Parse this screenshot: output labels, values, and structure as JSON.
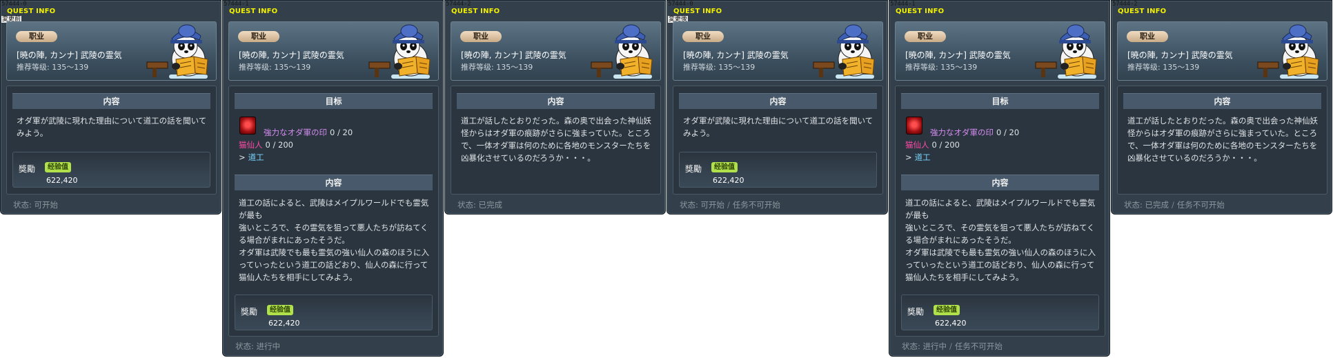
{
  "common": {
    "window_title": "QUEST INFO",
    "job_badge": "职业",
    "quest_name": "[暁の陣, カンナ] 武陵の霊気",
    "level": "推荐等级: 135～139",
    "section_goal": "目标",
    "section_content": "内容",
    "reward_label": "獎勵",
    "exp_label": "经验值",
    "exp_value": "622,420",
    "status_prefix": "状态:",
    "goal_mob": "強力なオダ軍の印",
    "goal_mob_count": "0 / 20",
    "goal_npc": "猫仙人",
    "goal_npc_count": "0 / 200",
    "goal_dest_arrow": ">",
    "goal_dest": "道工",
    "separator": "/",
    "npc_icon": "panda-npc-reading-icon",
    "goal_icon": "red-seal-icon",
    "colors": {
      "panel_bg": "#33404b",
      "title": "#f4f100",
      "exp_badge": "#b0e14a",
      "mob": "#d58cf2",
      "npc": "#ff4aa8",
      "dest": "#78d6ff"
    }
  },
  "panels": [
    {
      "id": "57444-0",
      "sub": "変更前",
      "content": "オダ軍が武陵に現れた理由について道工の話を聞いてみよう。",
      "status": "可开始",
      "status_extra": ""
    },
    {
      "id": "57444-1",
      "content": "道工の話によると、武陵はメイプルワールドでも霊気が最も\n強いところで、その霊気を狙って悪人たちが訪ねてくる場合がまれにあったそうだ。\nオダ軍は武陵でも最も霊気の強い仙人の森のほうに入っていったという道工の話どおり、仙人の森に行って猫仙人たちを相手にしてみよう。",
      "status": "进行中",
      "status_extra": ""
    },
    {
      "id": "57444-2",
      "content": "道工が話したとおりだった。森の奥で出会った神仙妖怪からはオダ軍の痕跡がさらに強まっていた。ところで、一体オダ軍は何のために各地のモンスターたちを凶暴化させているのだろうか・・・。",
      "status": "已完成",
      "status_extra": ""
    },
    {
      "id": "57444-0",
      "sub": "変更後",
      "content": "オダ軍が武陵に現れた理由について道工の話を聞いてみよう。",
      "status": "可开始",
      "status_extra": "任务不可开始"
    },
    {
      "id": "57444-1",
      "content": "道工の話によると、武陵はメイプルワールドでも霊気が最も\n強いところで、その霊気を狙って悪人たちが訪ねてくる場合がまれにあったそうだ。\nオダ軍は武陵でも最も霊気の強い仙人の森のほうに入っていったという道工の話どおり、仙人の森に行って猫仙人たちを相手にしてみよう。",
      "status": "进行中",
      "status_extra": "任务不可开始"
    },
    {
      "id": "57444-2",
      "content": "道工が話したとおりだった。森の奥で出会った神仙妖怪からはオダ軍の痕跡がさらに強まっていた。ところで、一体オダ軍は何のために各地のモンスターたちを凶暴化させているのだろうか・・・。",
      "status": "已完成",
      "status_extra": "任务不可开始"
    }
  ]
}
